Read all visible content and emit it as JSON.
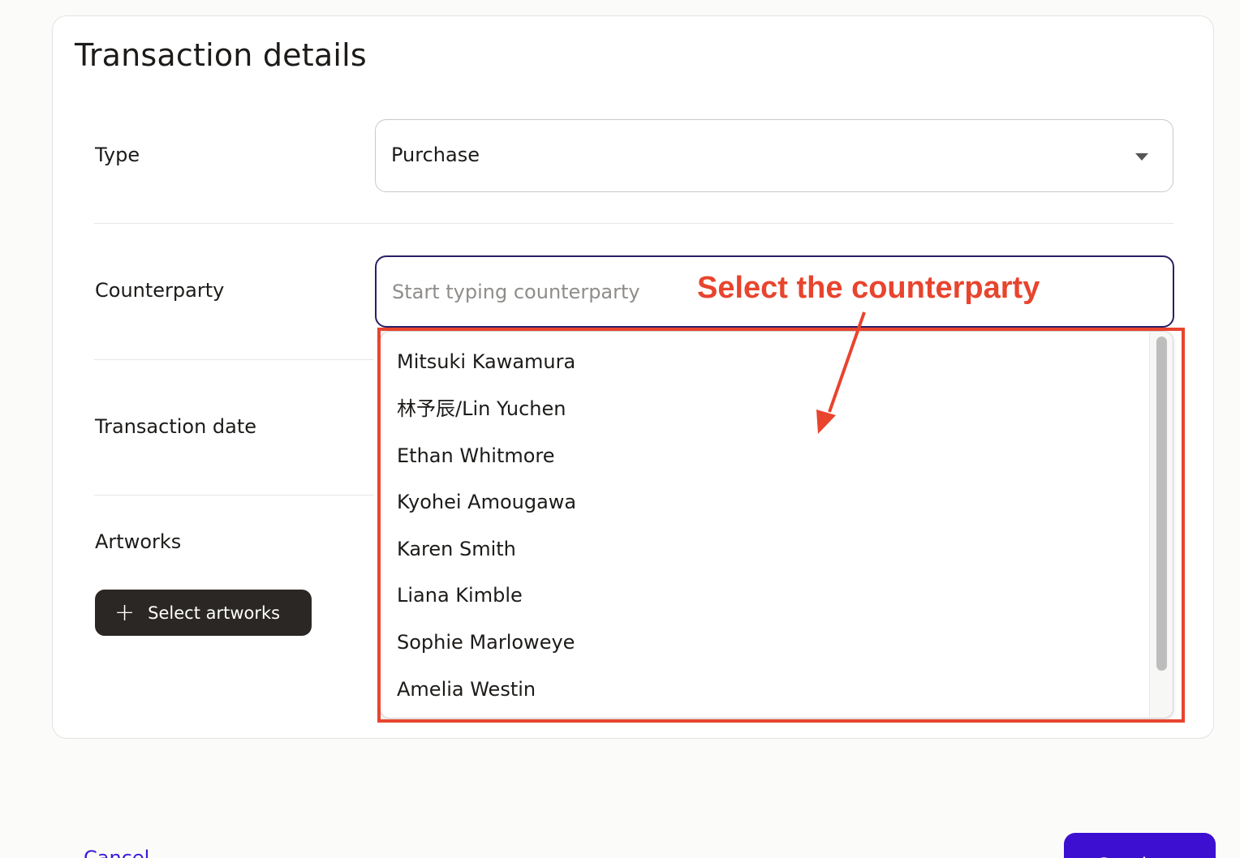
{
  "card": {
    "title": "Transaction details"
  },
  "type_field": {
    "label": "Type",
    "value": "Purchase"
  },
  "counterparty_field": {
    "label": "Counterparty",
    "placeholder": "Start typing counterparty",
    "options": [
      "Mitsuki Kawamura",
      "林予辰/Lin Yuchen",
      "Ethan Whitmore",
      "Kyohei Amougawa",
      "Karen Smith",
      "Liana Kimble",
      "Sophie Marloweye",
      "Amelia Westin"
    ]
  },
  "transaction_date_field": {
    "label": "Transaction date"
  },
  "artworks_field": {
    "label": "Artworks",
    "button_label": "Select artworks"
  },
  "annotation": {
    "text": "Select the counterparty",
    "color": "#e8442e"
  },
  "footer": {
    "cancel_label": "Cancel",
    "continue_label": "Continue"
  },
  "colors": {
    "primary": "#3d10d1",
    "dark_button": "#2a2724",
    "focus_border": "#2a1f66"
  }
}
